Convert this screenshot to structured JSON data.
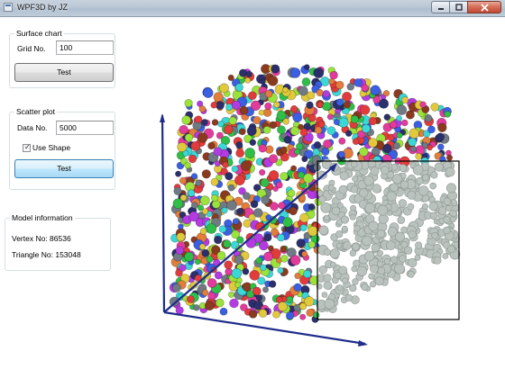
{
  "window": {
    "title": "WPF3D by JZ"
  },
  "surface_chart": {
    "header": "Surface chart",
    "grid_label": "Grid No.",
    "grid_value": "100",
    "test_label": "Test"
  },
  "scatter_plot": {
    "header": "Scatter plot",
    "data_label": "Data No.",
    "data_value": "5000",
    "use_shape_label": "Use Shape",
    "use_shape_checked": true,
    "test_label": "Test"
  },
  "model_info": {
    "header": "Model information",
    "vertex_text": "Vertex No: 86536",
    "triangle_text": "Triangle No: 153048"
  },
  "icons": [
    "app-icon",
    "minimize-icon",
    "maximize-icon",
    "close-icon",
    "checkmark-icon"
  ],
  "colors": {
    "axis": "#1f2d8a",
    "selection_box": "#000000",
    "selected_points": "#b9c2bd",
    "point_palette": [
      "#e23b3b",
      "#3b5fe2",
      "#2fbf48",
      "#e2c93b",
      "#b33be2",
      "#3bd6d6",
      "#e27d3b",
      "#8a3b1f",
      "#e23b9c",
      "#6f7a85",
      "#9be23b",
      "#2b2f6b"
    ]
  }
}
